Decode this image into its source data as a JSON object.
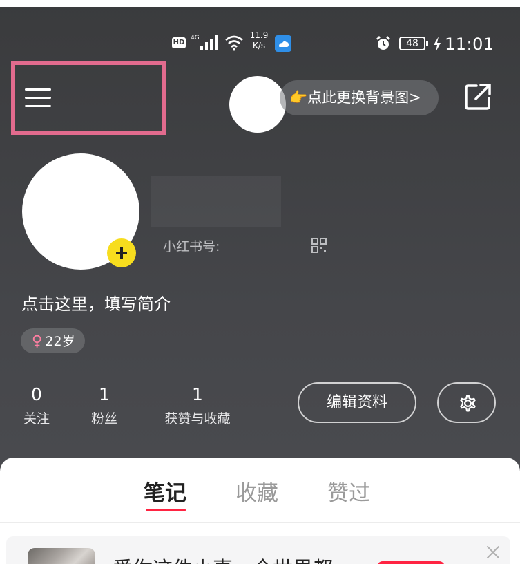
{
  "status_bar": {
    "hd_badge": "HD",
    "network_speed_value": "11.9",
    "network_speed_unit": "K/s",
    "battery_level": "48",
    "time": "11:01"
  },
  "header": {
    "change_background_label": "👉点此更换背景图>",
    "menu_icon": "hamburger-menu-icon",
    "share_icon": "external-share-icon"
  },
  "profile": {
    "red_id_label": "小红书号:",
    "bio_placeholder": "点击这里，填写简介",
    "gender_symbol": "♀",
    "age": "22岁"
  },
  "stats": [
    {
      "value": "0",
      "label": "关注"
    },
    {
      "value": "1",
      "label": "粉丝"
    },
    {
      "value": "1",
      "label": "获赞与收藏"
    }
  ],
  "actions": {
    "edit_profile_label": "编辑资料",
    "settings_icon": "gear-icon"
  },
  "tabs": [
    {
      "label": "笔记",
      "active": true
    },
    {
      "label": "收藏",
      "active": false
    },
    {
      "label": "赞过",
      "active": false
    }
  ],
  "card": {
    "title": "爱你这件小事，全世界都",
    "close_icon": "close-icon"
  },
  "colors": {
    "highlight": "#e26b8e",
    "accent": "#ff2442",
    "badge": "#f7dd1e"
  }
}
